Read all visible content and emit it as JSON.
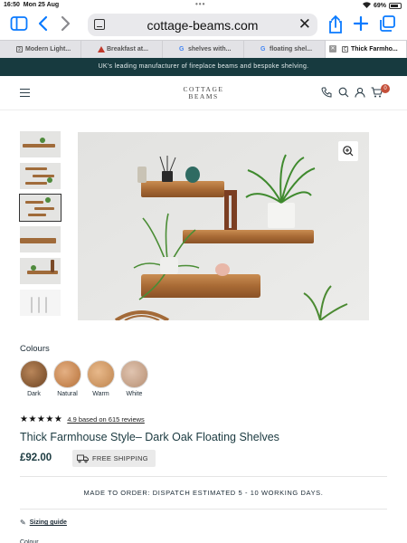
{
  "status_bar": {
    "time": "16:50",
    "date": "Mon 25 Aug",
    "battery": "69%"
  },
  "browser": {
    "url": "cottage-beams.com",
    "tabs": [
      {
        "label": "Modern Light...",
        "favicon": "2"
      },
      {
        "label": "Breakfast at...",
        "favicon": "triangle"
      },
      {
        "label": "shelves with...",
        "favicon": "G"
      },
      {
        "label": "floating shel...",
        "favicon": "G"
      },
      {
        "label": "Thick Farmho...",
        "favicon": "C",
        "active": true
      }
    ]
  },
  "announcement": "UK's leading manufacturer of fireplace beams and bespoke shelving.",
  "header": {
    "logo_line1": "COTTAGE",
    "logo_line2": "BEAMS",
    "cart_count": "0"
  },
  "product": {
    "colours_label": "Colours",
    "colours": [
      {
        "name": "Dark"
      },
      {
        "name": "Natural"
      },
      {
        "name": "Warm"
      },
      {
        "name": "White"
      }
    ],
    "stars": "★★★★★",
    "reviews_text": "4.9 based on 615 reviews",
    "title": "Thick Farmhouse Style– Dark Oak Floating Shelves",
    "price": "£92.00",
    "shipping_label": "FREE SHIPPING",
    "dispatch_text": "MADE TO ORDER: DISPATCH ESTIMATED 5 - 10 WORKING DAYS.",
    "sizing_label": "Sizing guide",
    "next_label": "Colour"
  },
  "colors": {
    "brand_dark": "#173a3f",
    "cart_badge": "#c4503a",
    "link_blue": "#0a7aff"
  },
  "icons": [
    "sidebar-icon",
    "back-icon",
    "forward-icon",
    "share-icon",
    "new-tab-icon",
    "tabs-icon",
    "phone-icon",
    "search-icon",
    "account-icon",
    "cart-icon",
    "zoom-icon",
    "truck-icon",
    "ruler-icon"
  ]
}
